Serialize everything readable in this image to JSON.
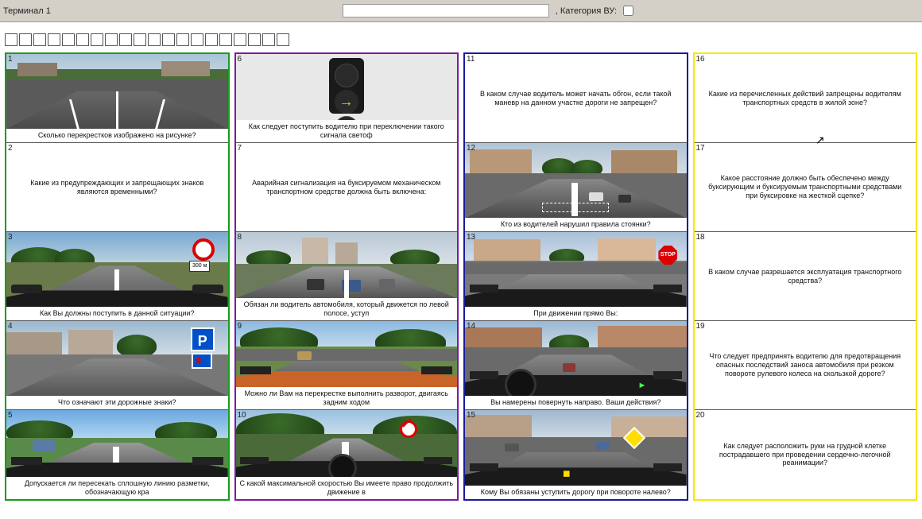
{
  "top": {
    "terminal_label": "Терминал 1",
    "category_label": ", Категория ВУ:"
  },
  "num_checkboxes": 20,
  "columns": [
    {
      "color": "green",
      "cards": [
        {
          "n": 1,
          "img": "intersection-topdown",
          "q": "Сколько перекрестков изображено на рисунке?"
        },
        {
          "n": 2,
          "img": null,
          "q": "Какие из предупреждающих и запрещающих знаков являются временными?"
        },
        {
          "n": 3,
          "img": "highway-sign-prohibit",
          "q": "Как Вы должны поступить в данной ситуации?"
        },
        {
          "n": 4,
          "img": "parking-sign-street",
          "q": "Что означают эти дорожные знаки?"
        },
        {
          "n": 5,
          "img": "rural-road-crossing",
          "q": "Допускается ли пересекать сплошную линию разметки, обозначающую кра"
        }
      ]
    },
    {
      "color": "purple",
      "cards": [
        {
          "n": 6,
          "img": "traffic-light-yellow-arrow",
          "q": "Как следует поступить водителю при переключении такого сигнала светоф"
        },
        {
          "n": 7,
          "img": null,
          "q": "Аварийная сигнализация на буксируемом механическом транспортном средстве должна быть включена:"
        },
        {
          "n": 8,
          "img": "city-wide-road-cars",
          "q": "Обязан ли водитель автомобиля, который движется по левой полосе, уступ"
        },
        {
          "n": 9,
          "img": "intersection-green-trees",
          "q": "Можно ли Вам на перекрестке выполнить разворот, двигаясь задним ходом"
        },
        {
          "n": 10,
          "img": "forest-road-sign",
          "q": "С какой максимальной скоростью Вы имеете право продолжить движение в"
        }
      ]
    },
    {
      "color": "blue",
      "cards": [
        {
          "n": 11,
          "img": null,
          "q": "В каком случае водитель может начать обгон, если такой маневр на данном участке дороги не запрещен?"
        },
        {
          "n": 12,
          "img": "city-street-parked",
          "q": "Кто из водителей нарушил правила стоянки?"
        },
        {
          "n": 13,
          "img": "stop-sign-intersection",
          "q": "При движении прямо Вы:"
        },
        {
          "n": 14,
          "img": "right-turn-dashboard",
          "q": "Вы намерены повернуть направо. Ваши действия?"
        },
        {
          "n": 15,
          "img": "priority-intersection",
          "q": "Кому Вы обязаны уступить дорогу при повороте налево?"
        }
      ]
    },
    {
      "color": "yellow",
      "cards": [
        {
          "n": 16,
          "img": null,
          "q": "Какие из перечисленных действий запрещены водителям транспортных средств в жилой зоне?"
        },
        {
          "n": 17,
          "img": null,
          "q": "Какое расстояние должно быть обеспечено между буксирующим и буксируемым транспортными средствами при буксировке на жесткой сцепке?"
        },
        {
          "n": 18,
          "img": null,
          "q": "В каком случае разрешается эксплуатация транспортного средства?"
        },
        {
          "n": 19,
          "img": null,
          "q": "Что следует предпринять водителю для предотвращения опасных последствий заноса автомобиля при резком повороте рулевого колеса на скользкой дороге?"
        },
        {
          "n": 20,
          "img": null,
          "q": "Как следует расположить руки на грудной клетке пострадавшего при проведении сердечно-легочной реанимации?"
        }
      ]
    }
  ]
}
